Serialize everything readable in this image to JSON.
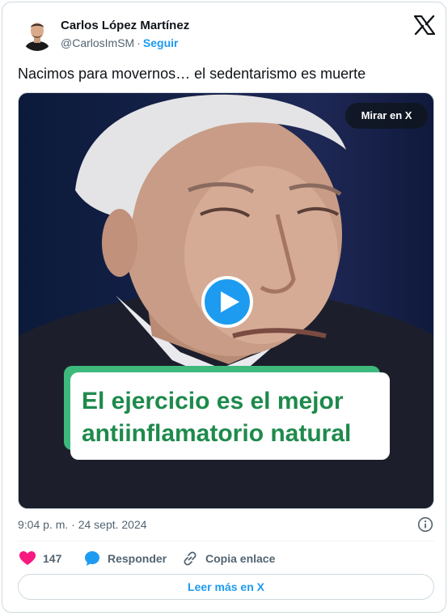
{
  "author": {
    "name": "Carlos López Martínez",
    "handle": "@CarlosImSM",
    "separator": "·",
    "follow_label": "Seguir"
  },
  "tweet": {
    "text": "Nacimos para movernos… el sedentarismo es muerte"
  },
  "media": {
    "watch_label": "Mirar en X",
    "caption_line1": "El ejercicio es el mejor",
    "caption_line2": "antiinflamatorio natural"
  },
  "meta": {
    "timestamp": "9:04 p. m. · 24 sept. 2024"
  },
  "actions": {
    "like_count": "147",
    "reply_label": "Responder",
    "copy_label": "Copia enlace"
  },
  "read_more_label": "Leer más en X",
  "colors": {
    "brand_blue": "#1d9bf0",
    "like_pink": "#f91880",
    "caption_green": "#1e8a4c",
    "caption_border_green": "#3eb97c"
  },
  "icons": [
    "x-logo-icon",
    "play-icon",
    "info-icon",
    "heart-icon",
    "reply-bubble-icon",
    "link-icon"
  ]
}
